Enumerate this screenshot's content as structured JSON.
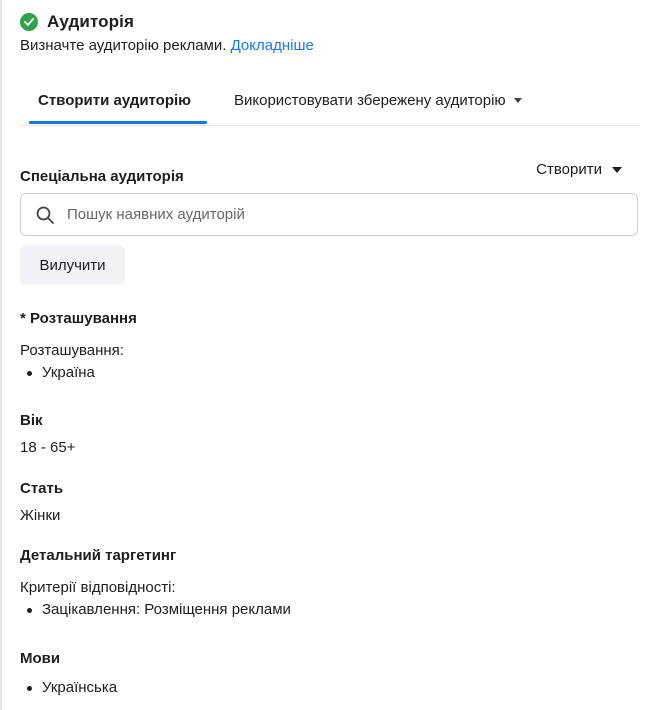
{
  "header": {
    "title": "Аудиторія",
    "subtitle": "Визначте аудиторію реклами.",
    "learn_more": "Докладніше"
  },
  "tabs": [
    {
      "label": "Створити аудиторію",
      "active": true
    },
    {
      "label": "Використовувати збережену аудиторію",
      "active": false
    }
  ],
  "custom_audience": {
    "label": "Спеціальна аудиторія",
    "create_label": "Створити",
    "search_placeholder": "Пошук наявних аудиторій",
    "search_value": "",
    "exclude_label": "Вилучити"
  },
  "location": {
    "label": "* Розташування",
    "sub_label": "Розташування:",
    "items": [
      "Україна"
    ]
  },
  "age": {
    "label": "Вік",
    "value": "18 - 65+"
  },
  "gender": {
    "label": "Стать",
    "value": "Жінки"
  },
  "detailed_targeting": {
    "label": "Детальний таргетинг",
    "sub_label": "Критерії відповідності:",
    "items": [
      "Зацікавлення: Розміщення реклами"
    ]
  },
  "languages": {
    "label": "Мови",
    "items": [
      "Українська"
    ]
  },
  "colors": {
    "accent": "#1b74e4",
    "link": "#1877f2",
    "success": "#31a24c"
  }
}
